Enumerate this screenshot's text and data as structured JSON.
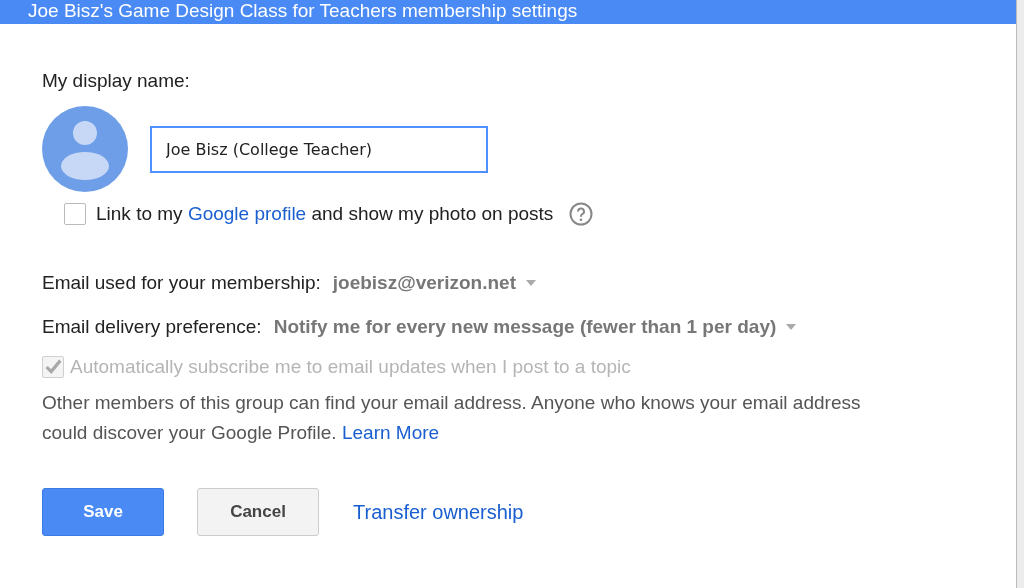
{
  "dialog": {
    "title": "Joe Bisz's Game Design Class for Teachers membership settings"
  },
  "display_name": {
    "label": "My display name:",
    "value": "Joe Bisz (College Teacher)"
  },
  "link_profile": {
    "checked": false,
    "before": "Link to my",
    "link": "Google profile",
    "after": "and show my photo on posts"
  },
  "email": {
    "label": "Email used for your membership:",
    "value": "joebisz@verizon.net"
  },
  "delivery": {
    "label": "Email delivery preference:",
    "value": "Notify me for every new message (fewer than 1 per day)"
  },
  "auto_subscribe": {
    "checked": true,
    "disabled": true,
    "label": "Automatically subscribe me to email updates when I post to a topic"
  },
  "notice": {
    "text": "Other members of this group can find your email address. Anyone who knows your email address could discover your Google Profile.",
    "link": "Learn More"
  },
  "buttons": [
    {
      "label": "Save",
      "kind": "primary"
    },
    {
      "label": "Cancel",
      "kind": "secondary"
    },
    {
      "label": "Transfer ownership",
      "kind": "link"
    }
  ]
}
